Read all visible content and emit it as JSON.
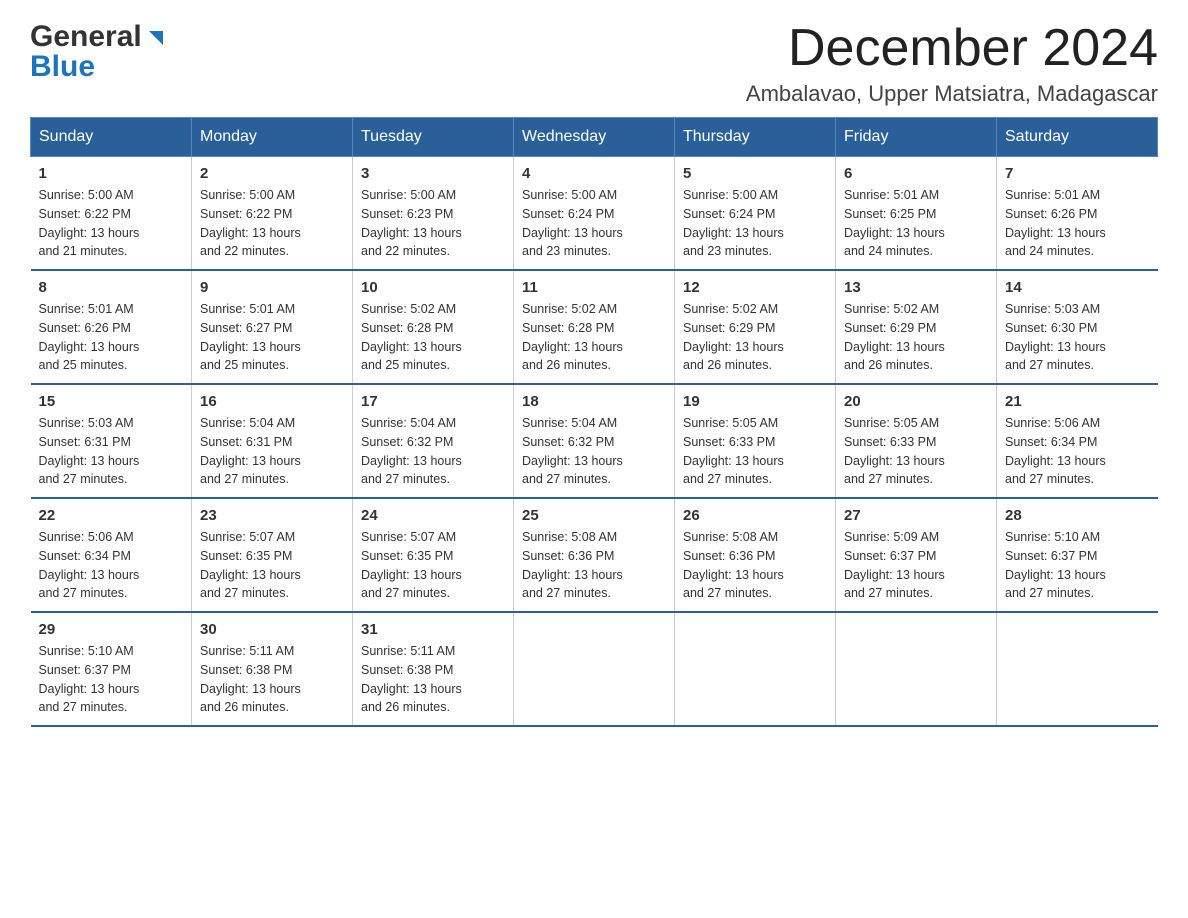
{
  "logo": {
    "line1": "General",
    "line2": "Blue"
  },
  "title": {
    "month_year": "December 2024",
    "location": "Ambalavao, Upper Matsiatra, Madagascar"
  },
  "header_colors": {
    "bg": "#2a6099",
    "text": "#ffffff"
  },
  "weekdays": [
    "Sunday",
    "Monday",
    "Tuesday",
    "Wednesday",
    "Thursday",
    "Friday",
    "Saturday"
  ],
  "weeks": [
    [
      {
        "day": "1",
        "sunrise": "5:00 AM",
        "sunset": "6:22 PM",
        "daylight": "13 hours and 21 minutes."
      },
      {
        "day": "2",
        "sunrise": "5:00 AM",
        "sunset": "6:22 PM",
        "daylight": "13 hours and 22 minutes."
      },
      {
        "day": "3",
        "sunrise": "5:00 AM",
        "sunset": "6:23 PM",
        "daylight": "13 hours and 22 minutes."
      },
      {
        "day": "4",
        "sunrise": "5:00 AM",
        "sunset": "6:24 PM",
        "daylight": "13 hours and 23 minutes."
      },
      {
        "day": "5",
        "sunrise": "5:00 AM",
        "sunset": "6:24 PM",
        "daylight": "13 hours and 23 minutes."
      },
      {
        "day": "6",
        "sunrise": "5:01 AM",
        "sunset": "6:25 PM",
        "daylight": "13 hours and 24 minutes."
      },
      {
        "day": "7",
        "sunrise": "5:01 AM",
        "sunset": "6:26 PM",
        "daylight": "13 hours and 24 minutes."
      }
    ],
    [
      {
        "day": "8",
        "sunrise": "5:01 AM",
        "sunset": "6:26 PM",
        "daylight": "13 hours and 25 minutes."
      },
      {
        "day": "9",
        "sunrise": "5:01 AM",
        "sunset": "6:27 PM",
        "daylight": "13 hours and 25 minutes."
      },
      {
        "day": "10",
        "sunrise": "5:02 AM",
        "sunset": "6:28 PM",
        "daylight": "13 hours and 25 minutes."
      },
      {
        "day": "11",
        "sunrise": "5:02 AM",
        "sunset": "6:28 PM",
        "daylight": "13 hours and 26 minutes."
      },
      {
        "day": "12",
        "sunrise": "5:02 AM",
        "sunset": "6:29 PM",
        "daylight": "13 hours and 26 minutes."
      },
      {
        "day": "13",
        "sunrise": "5:02 AM",
        "sunset": "6:29 PM",
        "daylight": "13 hours and 26 minutes."
      },
      {
        "day": "14",
        "sunrise": "5:03 AM",
        "sunset": "6:30 PM",
        "daylight": "13 hours and 27 minutes."
      }
    ],
    [
      {
        "day": "15",
        "sunrise": "5:03 AM",
        "sunset": "6:31 PM",
        "daylight": "13 hours and 27 minutes."
      },
      {
        "day": "16",
        "sunrise": "5:04 AM",
        "sunset": "6:31 PM",
        "daylight": "13 hours and 27 minutes."
      },
      {
        "day": "17",
        "sunrise": "5:04 AM",
        "sunset": "6:32 PM",
        "daylight": "13 hours and 27 minutes."
      },
      {
        "day": "18",
        "sunrise": "5:04 AM",
        "sunset": "6:32 PM",
        "daylight": "13 hours and 27 minutes."
      },
      {
        "day": "19",
        "sunrise": "5:05 AM",
        "sunset": "6:33 PM",
        "daylight": "13 hours and 27 minutes."
      },
      {
        "day": "20",
        "sunrise": "5:05 AM",
        "sunset": "6:33 PM",
        "daylight": "13 hours and 27 minutes."
      },
      {
        "day": "21",
        "sunrise": "5:06 AM",
        "sunset": "6:34 PM",
        "daylight": "13 hours and 27 minutes."
      }
    ],
    [
      {
        "day": "22",
        "sunrise": "5:06 AM",
        "sunset": "6:34 PM",
        "daylight": "13 hours and 27 minutes."
      },
      {
        "day": "23",
        "sunrise": "5:07 AM",
        "sunset": "6:35 PM",
        "daylight": "13 hours and 27 minutes."
      },
      {
        "day": "24",
        "sunrise": "5:07 AM",
        "sunset": "6:35 PM",
        "daylight": "13 hours and 27 minutes."
      },
      {
        "day": "25",
        "sunrise": "5:08 AM",
        "sunset": "6:36 PM",
        "daylight": "13 hours and 27 minutes."
      },
      {
        "day": "26",
        "sunrise": "5:08 AM",
        "sunset": "6:36 PM",
        "daylight": "13 hours and 27 minutes."
      },
      {
        "day": "27",
        "sunrise": "5:09 AM",
        "sunset": "6:37 PM",
        "daylight": "13 hours and 27 minutes."
      },
      {
        "day": "28",
        "sunrise": "5:10 AM",
        "sunset": "6:37 PM",
        "daylight": "13 hours and 27 minutes."
      }
    ],
    [
      {
        "day": "29",
        "sunrise": "5:10 AM",
        "sunset": "6:37 PM",
        "daylight": "13 hours and 27 minutes."
      },
      {
        "day": "30",
        "sunrise": "5:11 AM",
        "sunset": "6:38 PM",
        "daylight": "13 hours and 26 minutes."
      },
      {
        "day": "31",
        "sunrise": "5:11 AM",
        "sunset": "6:38 PM",
        "daylight": "13 hours and 26 minutes."
      },
      null,
      null,
      null,
      null
    ]
  ],
  "labels": {
    "sunrise": "Sunrise:",
    "sunset": "Sunset:",
    "daylight": "Daylight:"
  }
}
